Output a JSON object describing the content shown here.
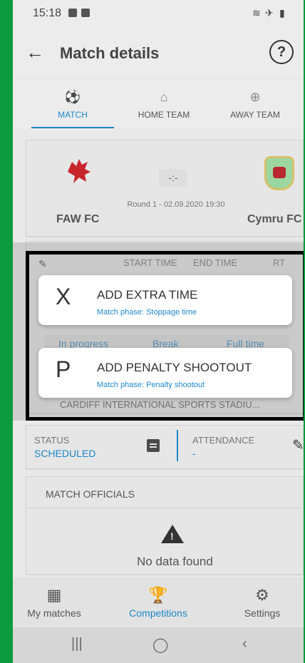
{
  "status_bar": {
    "time": "15:18"
  },
  "app_bar": {
    "title": "Match details"
  },
  "tabs": [
    {
      "label": "MATCH",
      "active": true
    },
    {
      "label": "HOME TEAM",
      "active": false
    },
    {
      "label": "AWAY TEAM",
      "active": false
    }
  ],
  "match": {
    "home_team": "FAW FC",
    "away_team": "Cymru FC",
    "score": "-:-",
    "round_info": "Round 1 - 02.09.2020 19:30"
  },
  "times_header": {
    "start_time": "START TIME",
    "end_time": "END TIME",
    "rt": "RT"
  },
  "phases": {
    "in_progress": "In progress",
    "break": "Break",
    "full_time": "Full time"
  },
  "stadium": "CARDIFF INTERNATIONAL SPORTS STADIU...",
  "status_section": {
    "status_label": "STATUS",
    "status_value": "SCHEDULED",
    "attendance_label": "ATTENDANCE",
    "attendance_value": "-"
  },
  "officials": {
    "title": "MATCH OFFICIALS",
    "empty": "No data found"
  },
  "popup_menu": [
    {
      "letter": "X",
      "title": "ADD EXTRA TIME",
      "subtitle": "Match phase: Stoppage time"
    },
    {
      "letter": "P",
      "title": "ADD PENALTY SHOOTOUT",
      "subtitle": "Match phase: Penalty shootout"
    }
  ],
  "bottom_nav": [
    {
      "label": "My matches",
      "icon": "pitch-icon",
      "active": false
    },
    {
      "label": "Competitions",
      "icon": "trophy-icon",
      "active": true
    },
    {
      "label": "Settings",
      "icon": "gear-icon",
      "active": false
    }
  ],
  "colors": {
    "accent": "#1d88c8",
    "background": "#0c9a3e"
  }
}
